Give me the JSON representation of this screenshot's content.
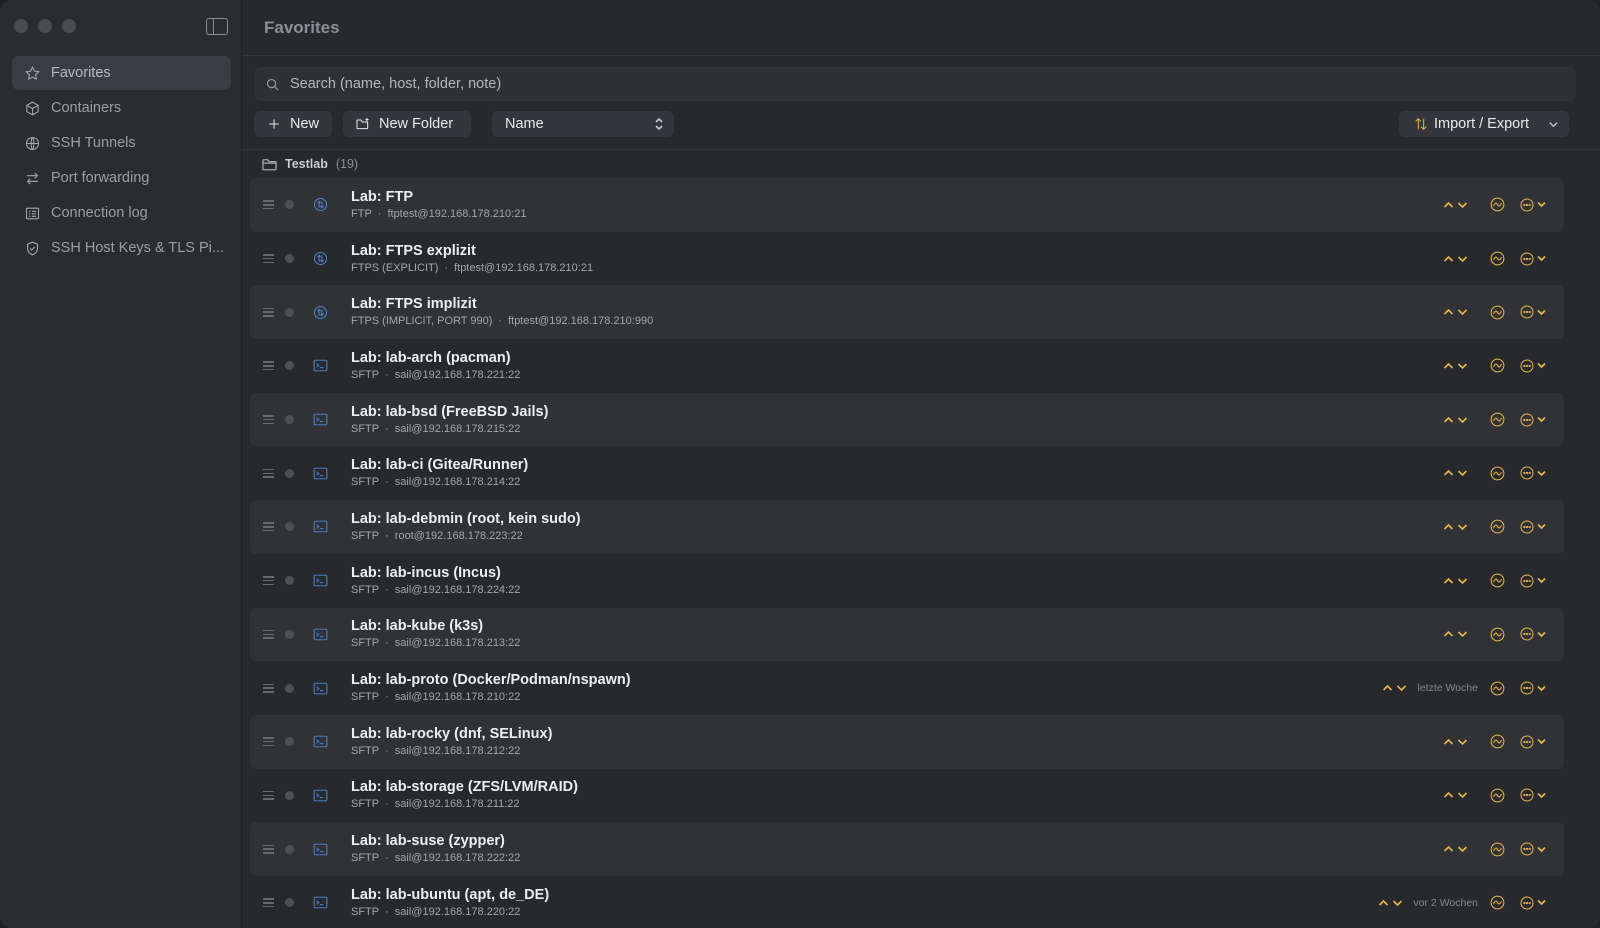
{
  "window": {
    "title": "Favorites"
  },
  "sidebar": {
    "items": [
      {
        "label": "Favorites",
        "icon": "star-icon",
        "active": true
      },
      {
        "label": "Containers",
        "icon": "cube-icon",
        "active": false
      },
      {
        "label": "SSH Tunnels",
        "icon": "globe-icon",
        "active": false
      },
      {
        "label": "Port forwarding",
        "icon": "swap-arrows-icon",
        "active": false
      },
      {
        "label": "Connection log",
        "icon": "list-icon",
        "active": false
      },
      {
        "label": "SSH Host Keys & TLS Pi...",
        "icon": "shield-icon",
        "active": false
      }
    ]
  },
  "search": {
    "placeholder": "Search (name, host, folder, note)",
    "value": ""
  },
  "toolbar": {
    "new_label": "New",
    "new_folder_label": "New Folder",
    "sort_value": "Name",
    "import_export_label": "Import / Export"
  },
  "group": {
    "name": "Testlab",
    "count": "(19)"
  },
  "connections": [
    {
      "name": "Lab: FTP",
      "protocol": "FTP",
      "address": "ftptest@192.168.178.210:21",
      "icon": "transfer-icon",
      "last_used": ""
    },
    {
      "name": "Lab: FTPS explizit",
      "protocol": "FTPS (EXPLICIT)",
      "address": "ftptest@192.168.178.210:21",
      "icon": "transfer-icon",
      "last_used": ""
    },
    {
      "name": "Lab: FTPS implizit",
      "protocol": "FTPS (IMPLICIT, PORT 990)",
      "address": "ftptest@192.168.178.210:990",
      "icon": "transfer-icon",
      "last_used": ""
    },
    {
      "name": "Lab: lab-arch (pacman)",
      "protocol": "SFTP",
      "address": "sail@192.168.178.221:22",
      "icon": "terminal-icon",
      "last_used": ""
    },
    {
      "name": "Lab: lab-bsd (FreeBSD Jails)",
      "protocol": "SFTP",
      "address": "sail@192.168.178.215:22",
      "icon": "terminal-icon",
      "last_used": ""
    },
    {
      "name": "Lab: lab-ci (Gitea/Runner)",
      "protocol": "SFTP",
      "address": "sail@192.168.178.214:22",
      "icon": "terminal-icon",
      "last_used": ""
    },
    {
      "name": "Lab: lab-debmin (root, kein sudo)",
      "protocol": "SFTP",
      "address": "root@192.168.178.223:22",
      "icon": "terminal-icon",
      "last_used": ""
    },
    {
      "name": "Lab: lab-incus (Incus)",
      "protocol": "SFTP",
      "address": "sail@192.168.178.224:22",
      "icon": "terminal-icon",
      "last_used": ""
    },
    {
      "name": "Lab: lab-kube (k3s)",
      "protocol": "SFTP",
      "address": "sail@192.168.178.213:22",
      "icon": "terminal-icon",
      "last_used": ""
    },
    {
      "name": "Lab: lab-proto (Docker/Podman/nspawn)",
      "protocol": "SFTP",
      "address": "sail@192.168.178.210:22",
      "icon": "terminal-icon",
      "last_used": "letzte Woche"
    },
    {
      "name": "Lab: lab-rocky (dnf, SELinux)",
      "protocol": "SFTP",
      "address": "sail@192.168.178.212:22",
      "icon": "terminal-icon",
      "last_used": ""
    },
    {
      "name": "Lab: lab-storage (ZFS/LVM/RAID)",
      "protocol": "SFTP",
      "address": "sail@192.168.178.211:22",
      "icon": "terminal-icon",
      "last_used": ""
    },
    {
      "name": "Lab: lab-suse (zypper)",
      "protocol": "SFTP",
      "address": "sail@192.168.178.222:22",
      "icon": "terminal-icon",
      "last_used": ""
    },
    {
      "name": "Lab: lab-ubuntu (apt, de_DE)",
      "protocol": "SFTP",
      "address": "sail@192.168.178.220:22",
      "icon": "terminal-icon",
      "last_used": "vor 2 Wochen"
    }
  ],
  "colors": {
    "accent": "#e8b64c",
    "protocol_icon": "#4f86d9",
    "background": "#27292d",
    "sidebar": "#2a2c30"
  }
}
